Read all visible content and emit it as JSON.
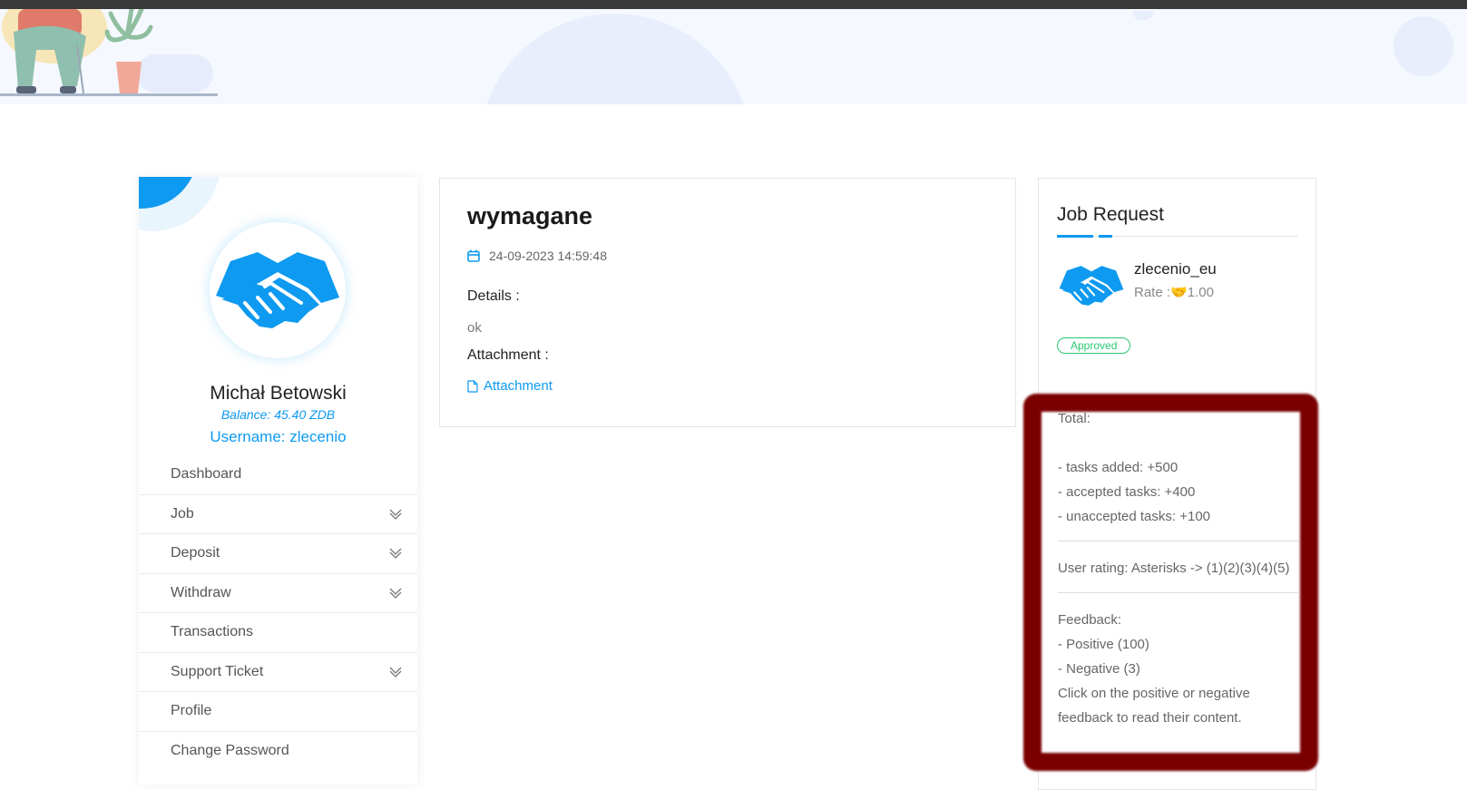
{
  "job": {
    "title": "wymagane",
    "date": "24-09-2023 14:59:48",
    "details_label": "Details :",
    "details_value": "ok",
    "attachment_label": "Attachment :",
    "attachment_link": "Attachment"
  },
  "profile": {
    "name": "Michał Betowski",
    "balance": "Balance: 45.40 ZDB",
    "username": "Username: zlecenio"
  },
  "menu": {
    "items": [
      {
        "label": "Dashboard",
        "has_submenu": false
      },
      {
        "label": "Job",
        "has_submenu": true
      },
      {
        "label": "Deposit",
        "has_submenu": true
      },
      {
        "label": "Withdraw",
        "has_submenu": true
      },
      {
        "label": "Transactions",
        "has_submenu": false
      },
      {
        "label": "Support Ticket",
        "has_submenu": true
      },
      {
        "label": "Profile",
        "has_submenu": false
      },
      {
        "label": "Change Password",
        "has_submenu": false
      }
    ]
  },
  "job_request": {
    "title": "Job Request",
    "requester_name": "zlecenio_eu",
    "rate_label": "Rate :",
    "rate_emoji": "🤝",
    "rate_value": "1.00",
    "status": "Approved"
  },
  "stats": {
    "total_label": "Total:",
    "tasks_added": "- tasks added: +500",
    "accepted_tasks": "- accepted tasks: +400",
    "unaccepted_tasks": "- unaccepted tasks: +100",
    "user_rating": "User rating: Asterisks -> (1)(2)(3)(4)(5)",
    "feedback_label": "Feedback:",
    "positive": "- Positive (100)",
    "negative": "- Negative (3)",
    "note": "Click on the positive or negative feedback to read their content."
  },
  "colors": {
    "accent": "#0d9af0",
    "approved": "#28c76f",
    "frame": "#7a0000"
  },
  "icons": [
    "calendar-icon",
    "file-icon",
    "chevron-down-icon",
    "handshake-icon"
  ]
}
